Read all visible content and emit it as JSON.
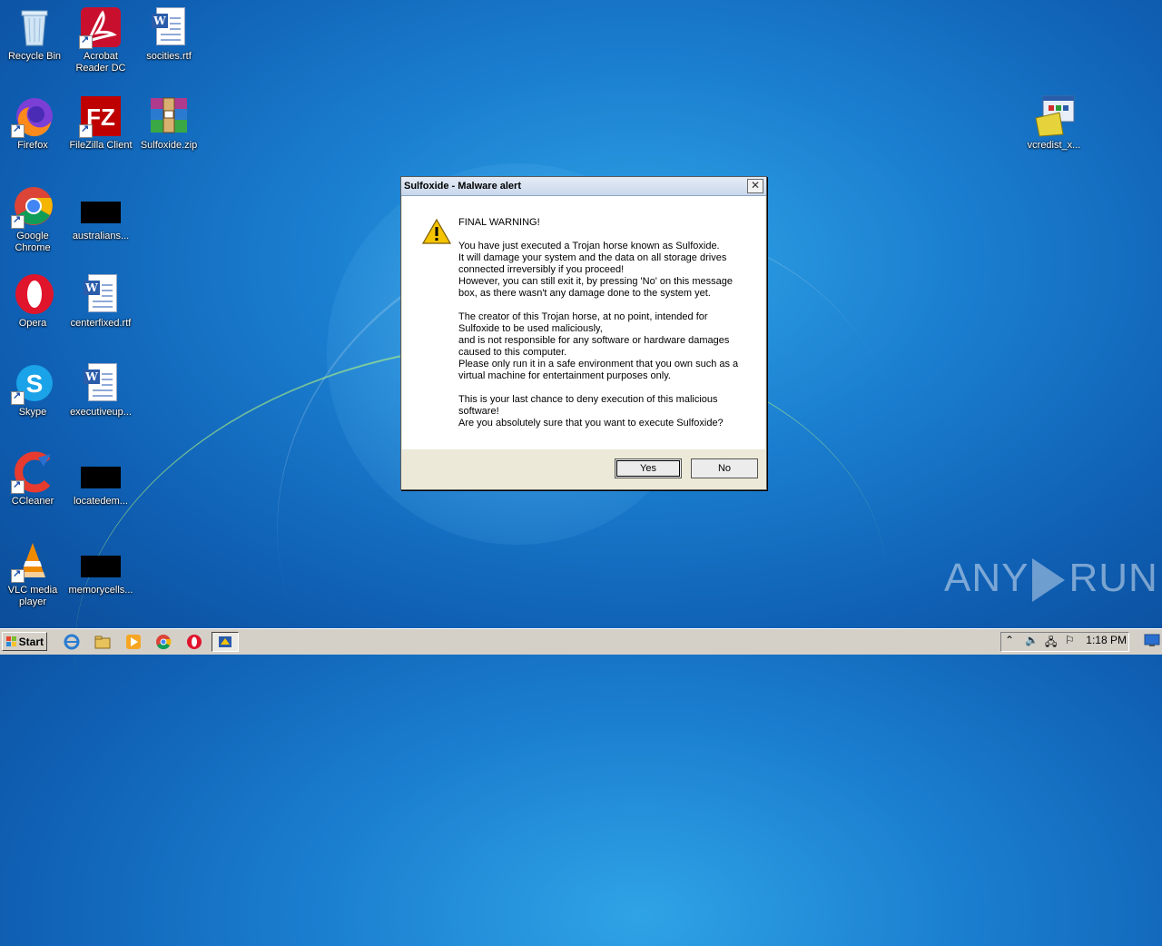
{
  "desktop": {
    "icons": [
      {
        "label": "Recycle Bin"
      },
      {
        "label": "Acrobat Reader DC"
      },
      {
        "label": "socities.rtf"
      },
      {
        "label": "Firefox"
      },
      {
        "label": "FileZilla Client"
      },
      {
        "label": "Sulfoxide.zip"
      },
      {
        "label": "Google Chrome"
      },
      {
        "label": "australians..."
      },
      {
        "label": "Opera"
      },
      {
        "label": "centerfixed.rtf"
      },
      {
        "label": "Skype"
      },
      {
        "label": "executiveup..."
      },
      {
        "label": "CCleaner"
      },
      {
        "label": "locatedem..."
      },
      {
        "label": "VLC media player"
      },
      {
        "label": "memorycells..."
      },
      {
        "label": "vcredist_x..."
      }
    ]
  },
  "dialog": {
    "title": "Sulfoxide - Malware alert",
    "close_label": "✕",
    "paragraphs": [
      "FINAL WARNING!",
      "You have just executed a Trojan horse known as Sulfoxide.\nIt will damage your system and the data on all storage drives\nconnected irreversibly if you proceed!\nHowever, you can still exit it, by pressing 'No' on this message\nbox, as there wasn't any damage done to the system yet.",
      "The creator of this Trojan horse, at no point, intended for\nSulfoxide to be used maliciously,\nand is not responsible for any software or hardware damages\ncaused to this computer.\nPlease only run it in a safe environment that you own such as a\nvirtual machine for entertainment purposes only.",
      "This is your last chance to deny execution of this malicious\nsoftware!\nAre you absolutely sure that you want to execute Sulfoxide?"
    ],
    "yes_label": "Yes",
    "no_label": "No",
    "icon": "warning-icon"
  },
  "taskbar": {
    "start_label": "Start",
    "pinned": [
      "internet-explorer-icon",
      "explorer-icon",
      "media-player-icon",
      "chrome-icon",
      "opera-icon",
      "sulfoxide-task-icon"
    ],
    "clock": "1:18 PM"
  },
  "watermark": {
    "left": "ANY",
    "right": "RUN"
  },
  "colors": {
    "accent": "#1b7fd0",
    "dialog_bg": "#ece9d8",
    "taskbar_bg": "#d4d0c8"
  }
}
